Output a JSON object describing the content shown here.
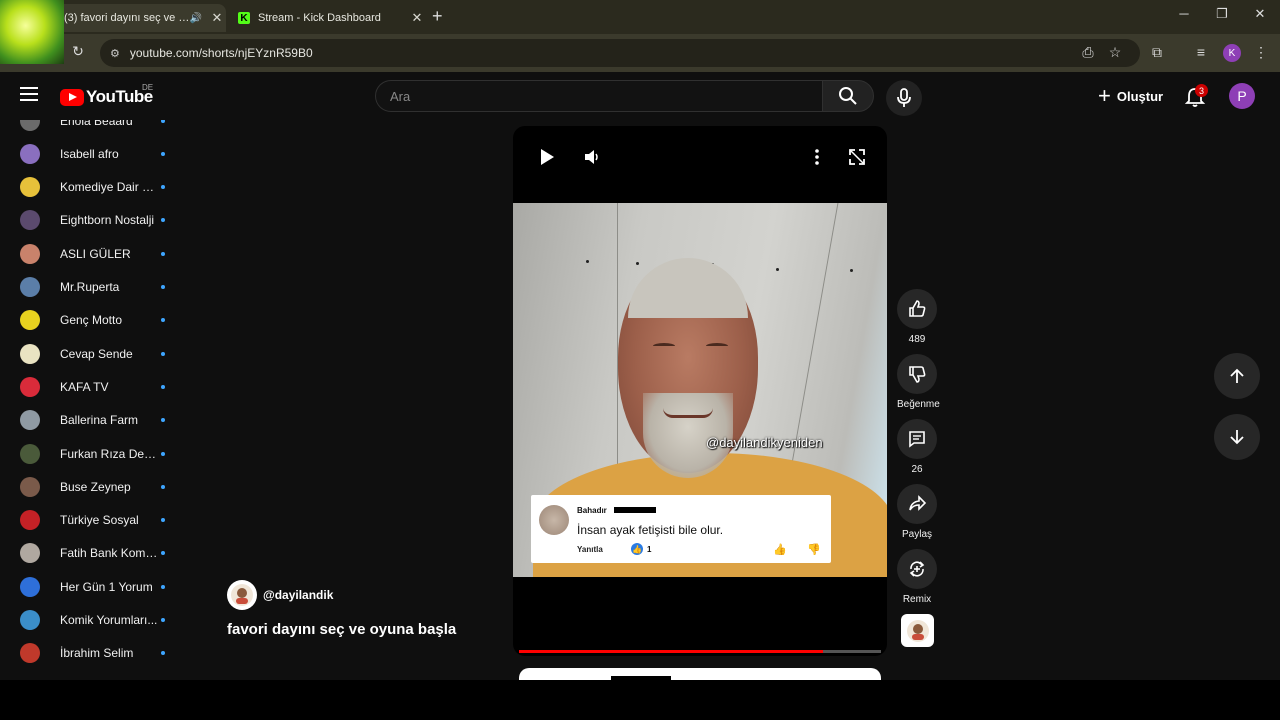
{
  "browser": {
    "tabs": [
      {
        "title": "(3) favori dayını seç ve oyun",
        "active": true
      },
      {
        "title": "Stream - Kick Dashboard",
        "active": false
      }
    ],
    "url": "youtube.com/shorts/njEYznR59B0",
    "profile_initial": "K"
  },
  "header": {
    "logo_text": "YouTube",
    "region": "DE",
    "search_placeholder": "Ara",
    "create_label": "Oluştur",
    "notification_count": "3",
    "avatar_initial": "P"
  },
  "sidebar": {
    "subscriptions": [
      {
        "name": "Ehoia Beaard",
        "color": "#6b6b6b"
      },
      {
        "name": "Isabell afro",
        "color": "#8a6fbf"
      },
      {
        "name": "Komediye Dair H...",
        "color": "#e7c13a"
      },
      {
        "name": "Eightborn Nostalji",
        "color": "#5b4a6e"
      },
      {
        "name": "ASLI GÜLER",
        "color": "#c9826b"
      },
      {
        "name": "Mr.Ruperta",
        "color": "#5b7ea8"
      },
      {
        "name": "Genç Motto",
        "color": "#e8d21f"
      },
      {
        "name": "Cevap Sende",
        "color": "#e9e3c2"
      },
      {
        "name": "KAFA TV",
        "color": "#d92b3a"
      },
      {
        "name": "Ballerina Farm",
        "color": "#8f9aa3"
      },
      {
        "name": "Furkan Rıza Dem...",
        "color": "#4a5a3a"
      },
      {
        "name": "Buse Zeynep",
        "color": "#7a5a4a"
      },
      {
        "name": "Türkiye Sosyal",
        "color": "#c42126"
      },
      {
        "name": "Fatih Bank Komb...",
        "color": "#b0a8a0"
      },
      {
        "name": "Her Gün 1 Yorum",
        "color": "#2e6fd9"
      },
      {
        "name": "Komik Yorumları...",
        "color": "#3b8ec9"
      },
      {
        "name": "İbrahim Selim",
        "color": "#c0392b"
      }
    ]
  },
  "short": {
    "watermark": "@dayilandikyeniden",
    "comment": {
      "author": "Bahadır",
      "text": "İnsan ayak fetişisti bile olur.",
      "reply_label": "Yanıtla",
      "likes": "1"
    },
    "progress_fraction": 0.84,
    "channel_handle": "@dayilandik",
    "title": "favori dayını seç ve oyuna başla"
  },
  "actions": {
    "like_count": "489",
    "dislike_label": "Beğenme",
    "comment_count": "26",
    "share_label": "Paylaş",
    "remix_label": "Remix"
  },
  "colors": {
    "accent_red": "#ff0000",
    "link_blue": "#3ea6ff",
    "avatar_purple": "#8e3fb6",
    "shirt": "#dca244"
  }
}
